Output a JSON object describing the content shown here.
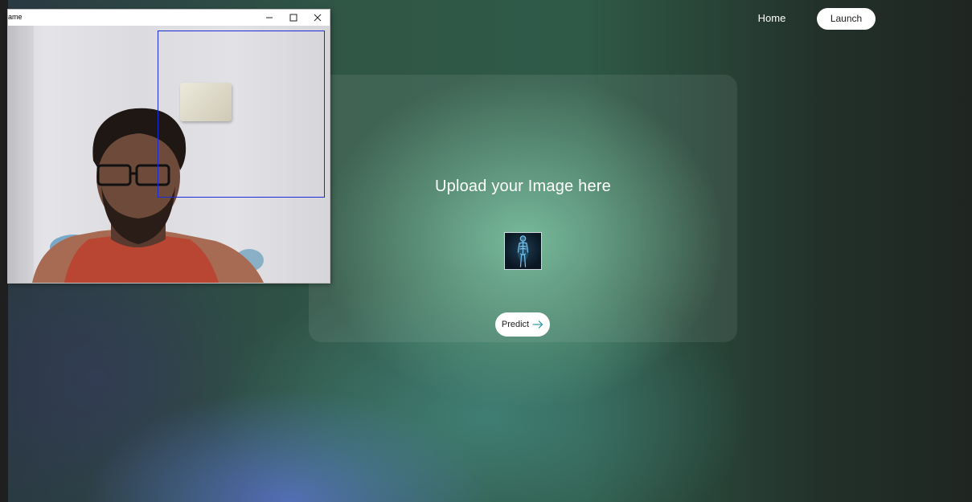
{
  "nav": {
    "home_label": "Home",
    "launch_label": "Launch"
  },
  "upload": {
    "title": "Upload your Image here",
    "predict_label": "Predict",
    "thumbnail_icon": "human-body-xray-icon"
  },
  "camera_window": {
    "title": "ame",
    "controls": [
      "minimize-icon",
      "maximize-icon",
      "close-icon"
    ]
  },
  "colors": {
    "button_bg": "#ffffff",
    "detection_box": "#1a2bd8",
    "arrow": "#3aa0a8"
  }
}
